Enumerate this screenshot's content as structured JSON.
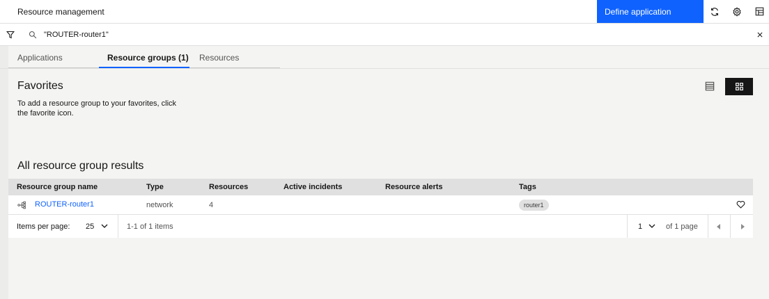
{
  "topbar": {
    "title": "Resource management",
    "define_button": "Define application",
    "icons": [
      "refresh-icon",
      "settings-icon",
      "dashboard-icon"
    ]
  },
  "search": {
    "query": "\"ROUTER-router1\"",
    "icons": [
      "filter-icon",
      "search-icon",
      "close-icon"
    ]
  },
  "tabs": [
    {
      "label": "Applications",
      "active": false
    },
    {
      "label": "Resource groups (1)",
      "active": true
    },
    {
      "label": "Resources",
      "active": false
    }
  ],
  "favorites": {
    "title": "Favorites",
    "description": "To add a resource group to your favorites, click the favorite icon."
  },
  "view_toggle": {
    "selected": "grid",
    "icons": [
      "list-view-icon",
      "grid-view-icon"
    ]
  },
  "results": {
    "title": "All resource group results",
    "columns": [
      "Resource group name",
      "Type",
      "Resources",
      "Active incidents",
      "Resource alerts",
      "Tags"
    ],
    "rows": [
      {
        "name": "ROUTER-router1",
        "type": "network",
        "resources": "4",
        "active_incidents": "",
        "resource_alerts": "",
        "tag": "router1"
      }
    ]
  },
  "pagination": {
    "items_per_page_label": "Items per page:",
    "items_per_page": "25",
    "range": "1-1 of 1 items",
    "page": "1",
    "of_pages": "of 1 page"
  }
}
